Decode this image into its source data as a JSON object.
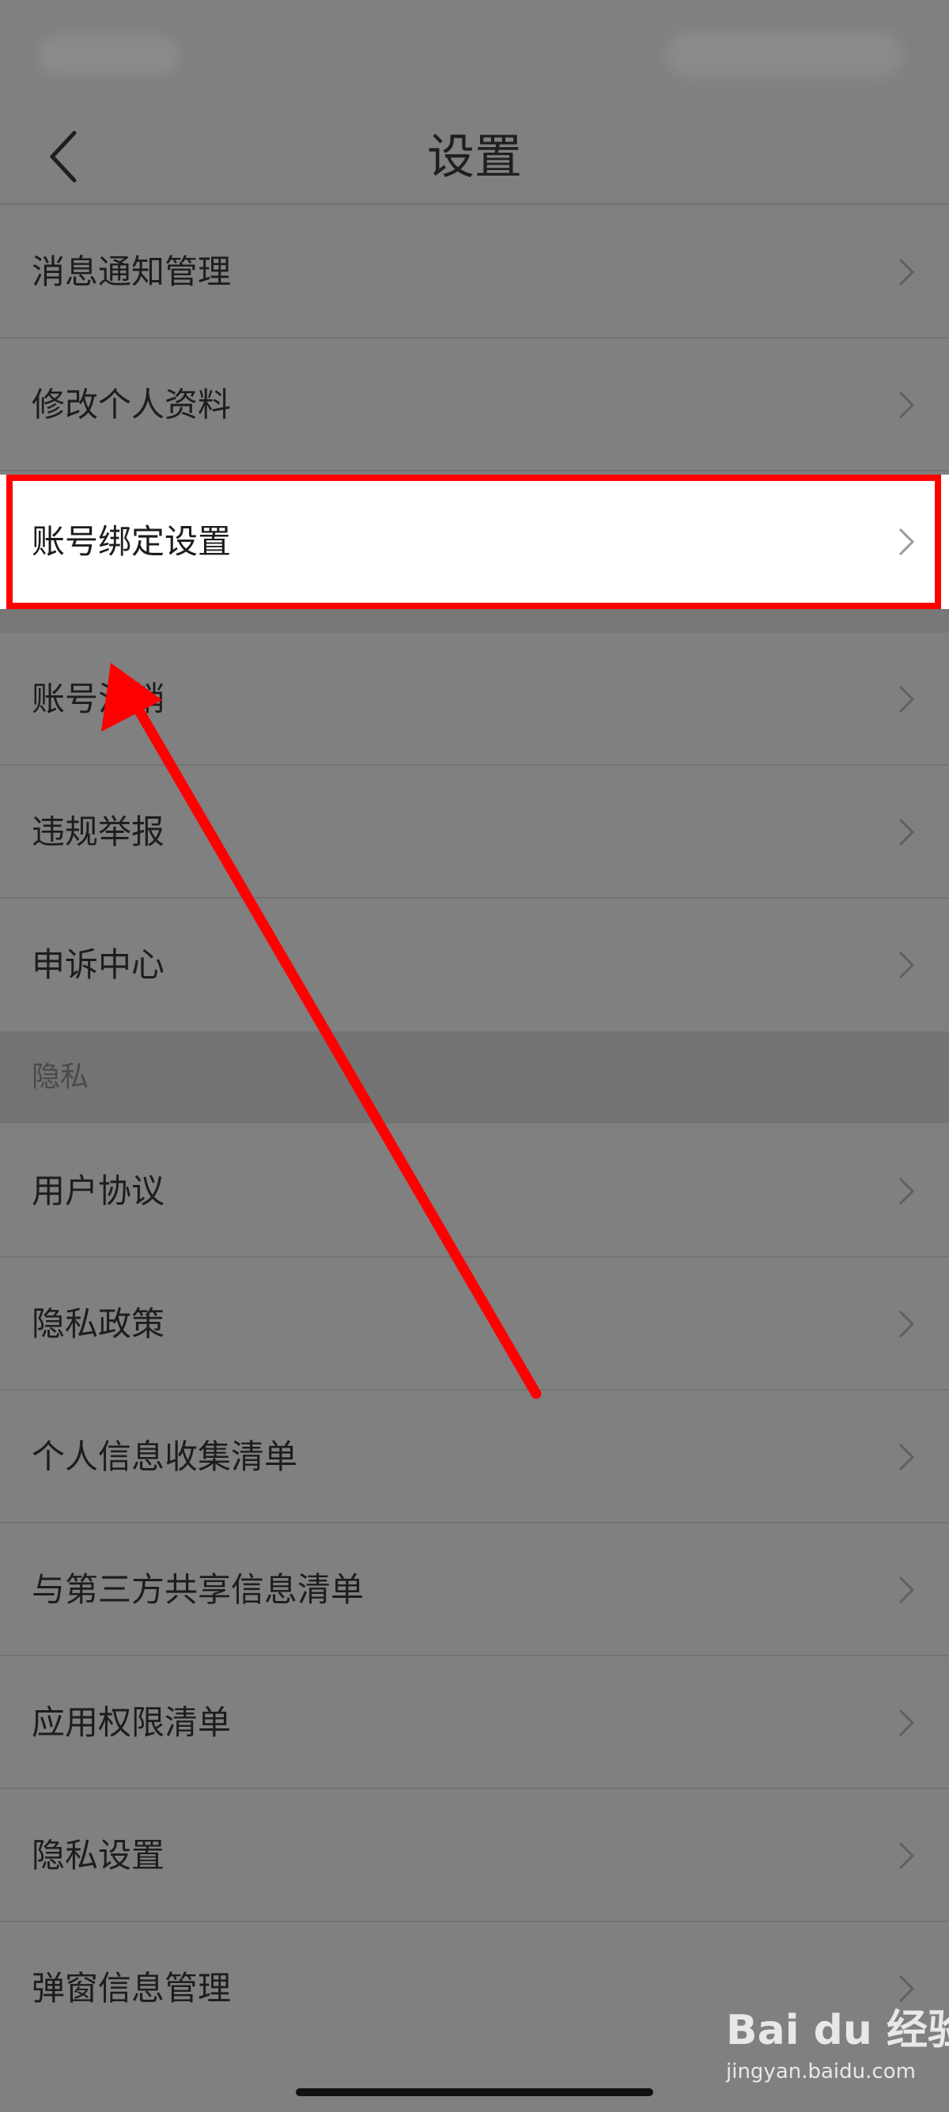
{
  "nav": {
    "title": "设置"
  },
  "settings": {
    "items": [
      {
        "label": "消息通知管理"
      },
      {
        "label": "修改个人资料"
      },
      {
        "label": "账号绑定设置"
      },
      {
        "label": "账号注销"
      },
      {
        "label": "违规举报"
      },
      {
        "label": "申诉中心"
      }
    ]
  },
  "privacy": {
    "header": "隐私",
    "items": [
      {
        "label": "用户协议"
      },
      {
        "label": "隐私政策"
      },
      {
        "label": "个人信息收集清单"
      },
      {
        "label": "与第三方共享信息清单"
      },
      {
        "label": "应用权限清单"
      },
      {
        "label": "隐私设置"
      },
      {
        "label": "弹窗信息管理"
      }
    ]
  },
  "annotation": {
    "highlight_color": "#ff0000"
  },
  "watermark": {
    "logo": "Bai du 经验",
    "url": "jingyan.baidu.com"
  },
  "icons": {
    "back": "chevron-left-icon",
    "row": "chevron-right-icon"
  }
}
